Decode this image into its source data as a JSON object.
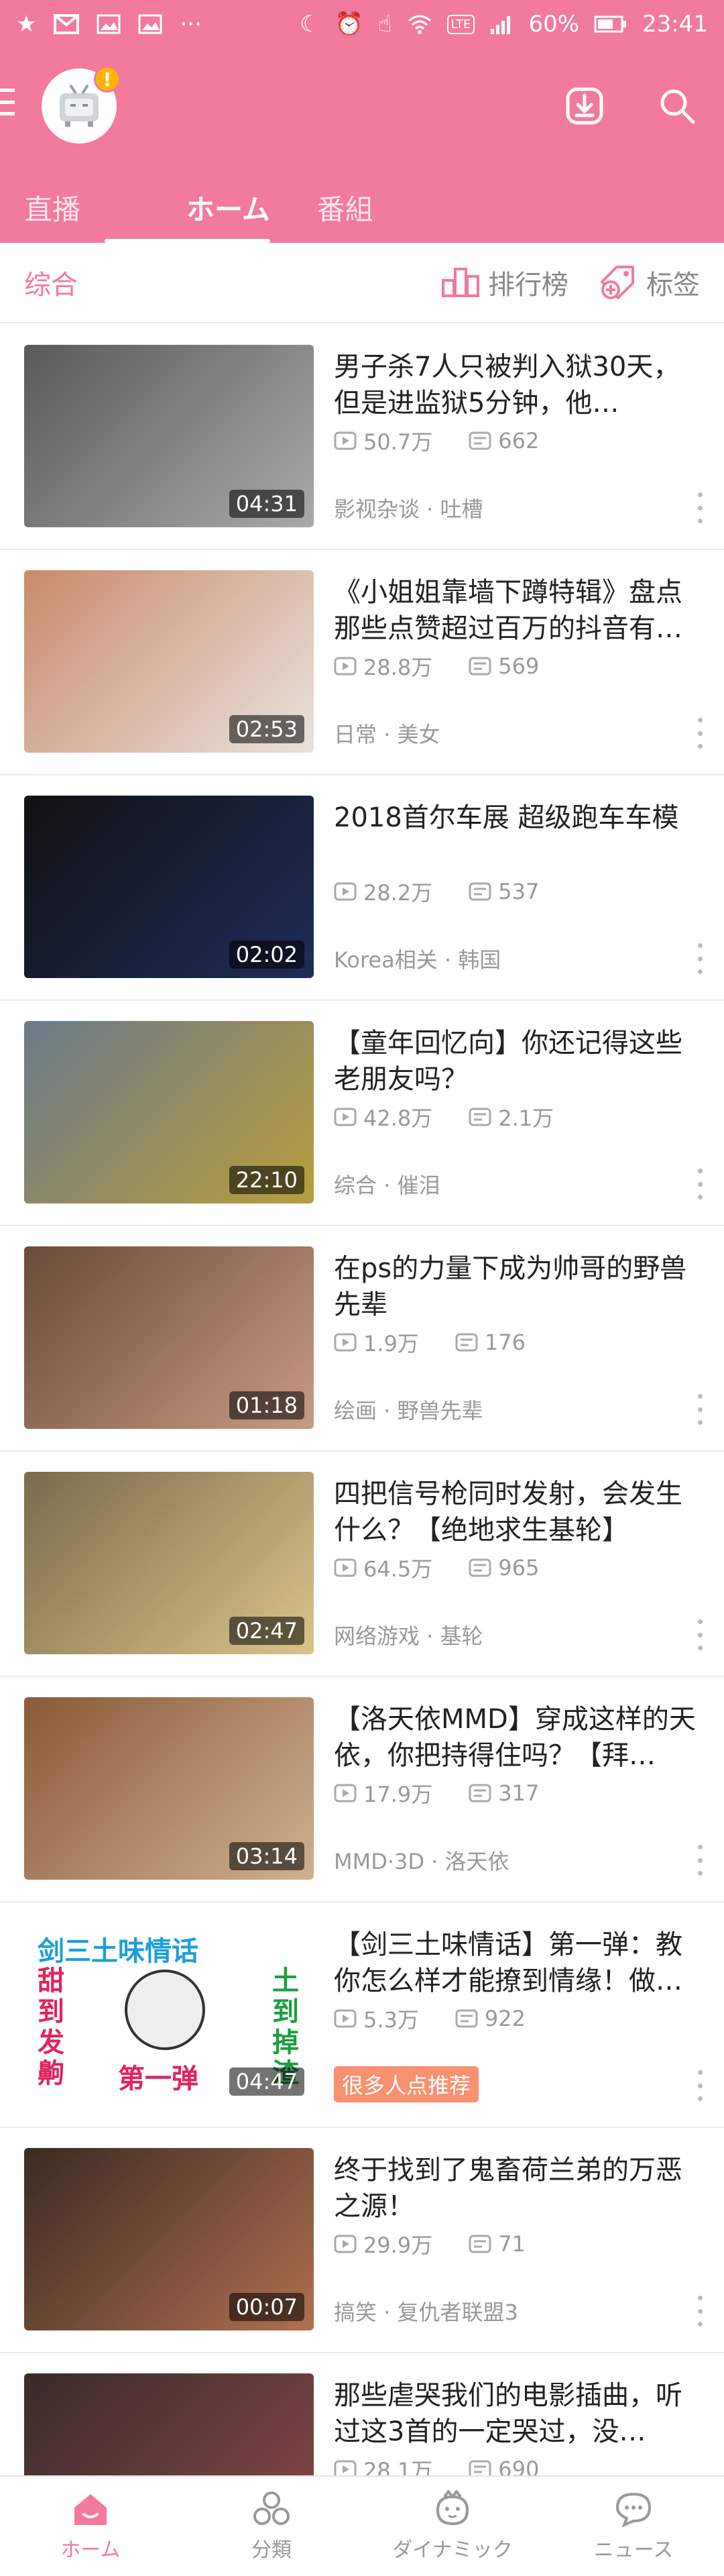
{
  "statusbar": {
    "battery": "60%",
    "time": "23:41",
    "network": "LTE"
  },
  "header": {
    "avatar_badge": "!"
  },
  "tabs": [
    {
      "label": "直播"
    },
    {
      "label": "ホーム"
    },
    {
      "label": "番組"
    }
  ],
  "subbar": {
    "category": "综合",
    "ranking": "排行榜",
    "tags": "标签"
  },
  "videos": [
    {
      "title": "男子杀7人只被判入狱30天，但是进监狱5分钟，他…",
      "duration": "04:31",
      "views": "50.7万",
      "comments": "662",
      "meta": "影视杂谈 · 吐槽",
      "thumb_colors": [
        "#5a5a5a",
        "#a9a9a9"
      ]
    },
    {
      "title": "《小姐姐靠墙下蹲特辑》盘点那些点赞超过百万的抖音有…",
      "duration": "02:53",
      "views": "28.8万",
      "comments": "569",
      "meta": "日常 · 美女",
      "thumb_colors": [
        "#c98b6b",
        "#e9e2dc"
      ]
    },
    {
      "title": "2018首尔车展 超级跑车车模",
      "duration": "02:02",
      "views": "28.2万",
      "comments": "537",
      "meta": "Korea相关 · 韩国",
      "thumb_colors": [
        "#111111",
        "#1f2d5a"
      ]
    },
    {
      "title": "【童年回忆向】你还记得这些老朋友吗？",
      "duration": "22:10",
      "views": "42.8万",
      "comments": "2.1万",
      "meta": "综合 · 催泪",
      "thumb_colors": [
        "#6a7a8a",
        "#b89d3c"
      ]
    },
    {
      "title": "在ps的力量下成为帅哥的野兽先辈",
      "duration": "01:18",
      "views": "1.9万",
      "comments": "176",
      "meta": "绘画 · 野兽先辈",
      "thumb_colors": [
        "#6b4b3a",
        "#c89a82"
      ]
    },
    {
      "title": "四把信号枪同时发射，会发生什么？【绝地求生基轮】",
      "duration": "02:47",
      "views": "64.5万",
      "comments": "965",
      "meta": "网络游戏 · 基轮",
      "thumb_colors": [
        "#7c6a4a",
        "#d9c48a"
      ]
    },
    {
      "title": "【洛天依MMD】穿成这样的天依，你把持得住吗？【拜…",
      "duration": "03:14",
      "views": "17.9万",
      "comments": "317",
      "meta": "MMD·3D · 洛天依",
      "thumb_colors": [
        "#8a5a3a",
        "#d0b090"
      ]
    },
    {
      "title": "【剑三土味情话】第一弹：教你怎么样才能撩到情缘！做…",
      "duration": "04:47",
      "views": "5.3万",
      "comments": "922",
      "meta": "",
      "badge": "很多人点推荐",
      "thumb_colors": [
        "#ffffff",
        "#ffffff"
      ],
      "thumb_texts": {
        "top": "剑三土味情话",
        "left": "甜到发齁",
        "right": "土到掉渣",
        "bottom": "第一弹"
      }
    },
    {
      "title": "终于找到了鬼畜荷兰弟的万恶之源！",
      "duration": "00:07",
      "views": "29.9万",
      "comments": "71",
      "meta": "搞笑 · 复仇者联盟3",
      "thumb_colors": [
        "#3b2a22",
        "#b0704f"
      ]
    },
    {
      "title": "那些虐哭我们的电影插曲，听过这3首的一定哭过，没…",
      "duration": "",
      "views": "28.1万",
      "comments": "690",
      "meta": "",
      "thumb_colors": [
        "#3a2a2a",
        "#8a4a4a"
      ]
    }
  ],
  "bottomnav": [
    {
      "label": "ホーム"
    },
    {
      "label": "分類"
    },
    {
      "label": "ダイナミック"
    },
    {
      "label": "ニュース"
    }
  ],
  "colors": {
    "accent": "#f27a9d",
    "badge": "#f8916f"
  }
}
